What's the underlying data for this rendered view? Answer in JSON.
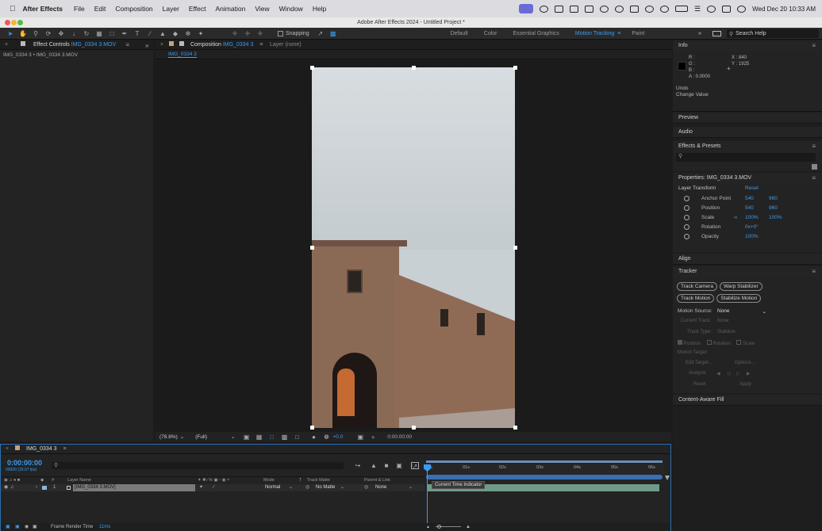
{
  "menubar": {
    "app": "After Effects",
    "items": [
      "File",
      "Edit",
      "Composition",
      "Layer",
      "Effect",
      "Animation",
      "View",
      "Window",
      "Help"
    ],
    "datetime": "Wed Dec 20  10:33 AM"
  },
  "window": {
    "title": "Adobe After Effects 2024 - Untitled Project *"
  },
  "toolbar": {
    "snapping": "Snapping",
    "workspaces": [
      "Default",
      "Color",
      "Essential Graphics",
      "Motion Tracking",
      "Paint"
    ],
    "active_workspace": "Motion Tracking",
    "search_placeholder": "Search Help"
  },
  "effect_controls": {
    "tab_prefix": "Effect Controls",
    "tab_layer": "IMG_0334 3.MOV",
    "subtitle": "IMG_0334 3 • IMG_0334 3.MOV"
  },
  "composition": {
    "tab_label": "Composition",
    "tab_name": "IMG_0334 3",
    "layer_tab": "Layer (none)",
    "subtab": "IMG_0334 3",
    "zoom": "(78.8%)",
    "resolution": "(Full)",
    "exposure": "+0.0",
    "timecode": "0:00:00:00"
  },
  "info": {
    "title": "Info",
    "r": "R :",
    "g": "G :",
    "b": "B :",
    "a": "A : 0.0000",
    "x": "X : 840",
    "y": "Y : 1925",
    "undo": "Undo",
    "undo_action": "Change Value"
  },
  "panels": {
    "preview": "Preview",
    "audio": "Audio",
    "effects_presets": "Effects & Presets",
    "align": "Align",
    "tracker": "Tracker",
    "content_aware": "Content-Aware Fill"
  },
  "properties": {
    "title": "Properties: IMG_0334 3.MOV",
    "group": "Layer Transform",
    "reset": "Reset",
    "rows": [
      {
        "name": "Anchor Point",
        "v1": "540",
        "v2": "960"
      },
      {
        "name": "Position",
        "v1": "540",
        "v2": "960"
      },
      {
        "name": "Scale",
        "v1": "100%",
        "v2": "100%"
      },
      {
        "name": "Rotation",
        "v1": "0x+0°",
        "v2": ""
      },
      {
        "name": "Opacity",
        "v1": "100%",
        "v2": ""
      }
    ]
  },
  "tracker": {
    "buttons": [
      "Track Camera",
      "Warp Stabilizer",
      "Track Motion",
      "Stabilize Motion"
    ],
    "motion_source_label": "Motion Source:",
    "motion_source": "None",
    "current_track": "Current Track:",
    "current_track_val": "None",
    "track_type": "Track Type:",
    "track_type_val": "Stabilize",
    "chk_position": "Position",
    "chk_rotation": "Rotation",
    "chk_scale": "Scale",
    "motion_target": "Motion Target:",
    "edit_target": "Edit Target...",
    "options": "Options...",
    "analyze": "Analyze:",
    "reset": "Reset",
    "apply": "Apply"
  },
  "timeline": {
    "comp_name": "IMG_0334 3",
    "timecode": "0:00:00:00",
    "fps": "00000 (29.97 fps)",
    "cols": {
      "layer_name": "Layer Name",
      "mode": "Mode",
      "t": "T",
      "track_matte": "Track Matte",
      "parent": "Parent & Link"
    },
    "layer": {
      "index": "1",
      "name": "[IMG_0334 3.MOV]",
      "mode": "Normal",
      "matte": "No Matte",
      "parent": "None"
    },
    "ruler": [
      "0s",
      "01s",
      "02s",
      "03s",
      "04s",
      "05s",
      "06s"
    ],
    "tooltip": "Current Time Indicator",
    "render_label": "Frame Render Time",
    "render_time": "11ms"
  },
  "colors": {
    "accent": "#3b9cf0",
    "sky": "#c9d0d4",
    "wall": "#8f6b55"
  }
}
